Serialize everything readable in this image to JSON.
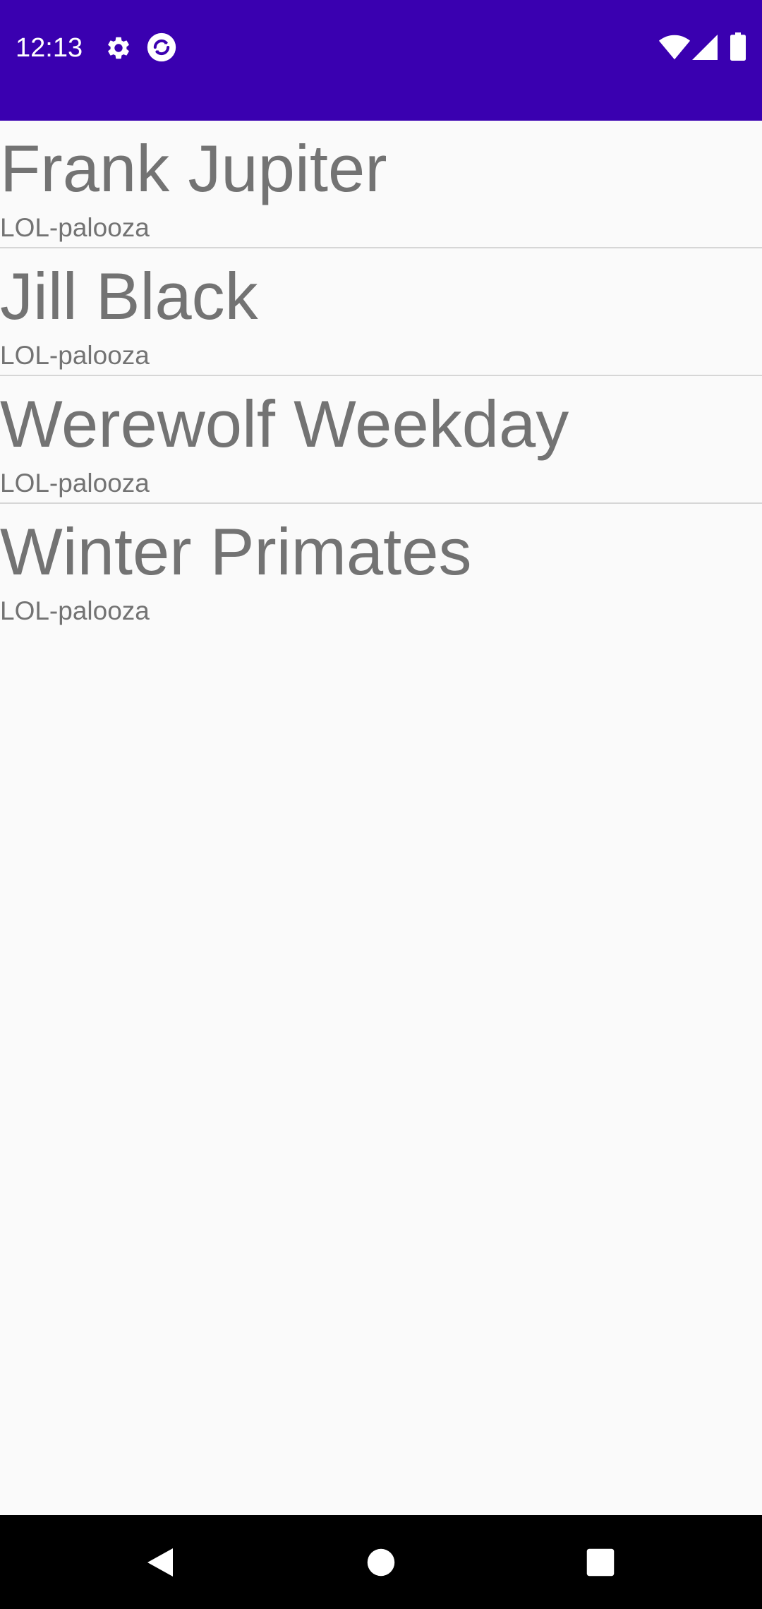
{
  "status_bar": {
    "time": "12:13",
    "left_icons": [
      "gear-icon",
      "sync-icon"
    ],
    "right_icons": [
      "wifi-icon",
      "cellular-signal-icon",
      "battery-icon"
    ],
    "background_color": "#3a00b0"
  },
  "list": {
    "items": [
      {
        "title": "Frank Jupiter",
        "subtitle": "LOL-palooza"
      },
      {
        "title": "Jill Black",
        "subtitle": "LOL-palooza"
      },
      {
        "title": "Werewolf Weekday",
        "subtitle": "LOL-palooza"
      },
      {
        "title": "Winter Primates",
        "subtitle": "LOL-palooza"
      }
    ],
    "text_color": "#737373",
    "divider_color": "#d6d6d6"
  },
  "nav_bar": {
    "buttons": [
      "back-icon",
      "home-icon",
      "recents-icon"
    ]
  }
}
